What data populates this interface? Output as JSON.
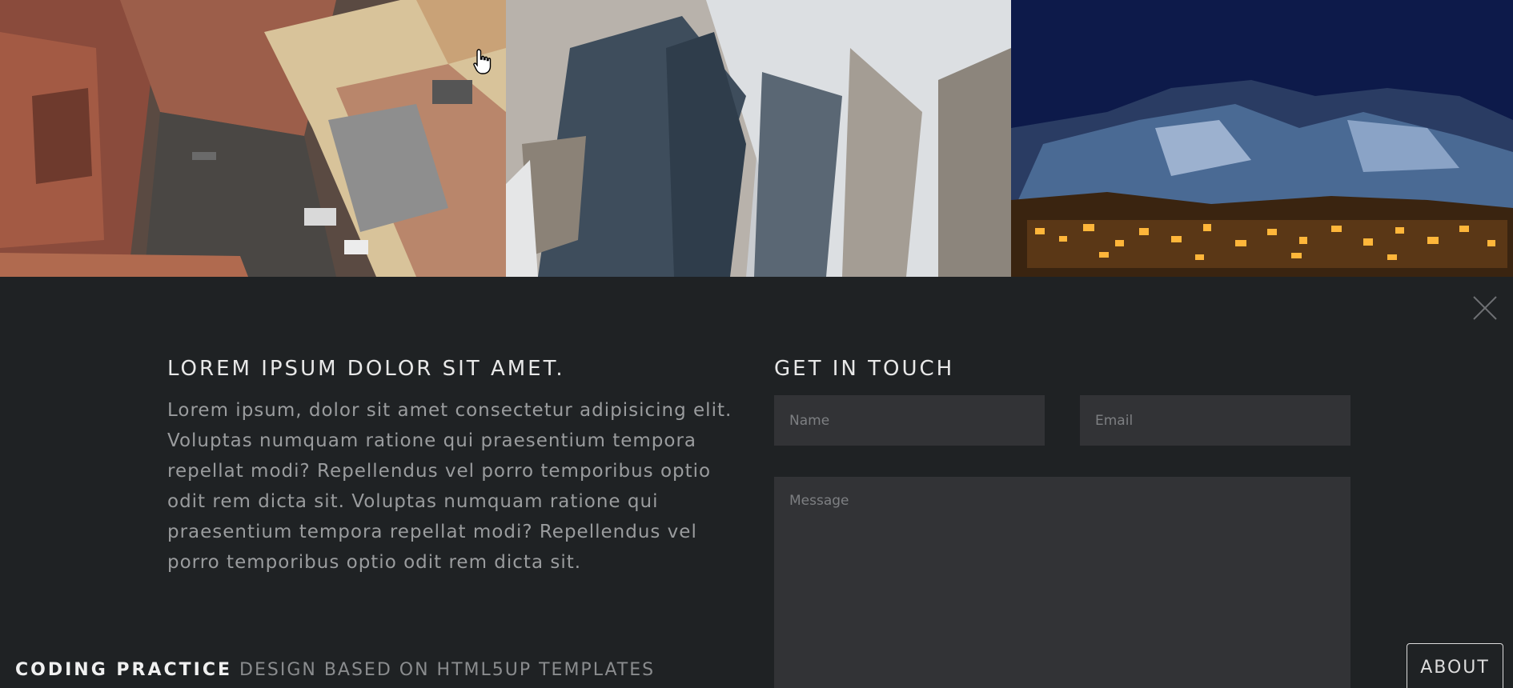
{
  "gallery": {
    "images": [
      {
        "name": "city-rooftops-aerial"
      },
      {
        "name": "snowy-rock-peaks"
      },
      {
        "name": "night-mountain-village"
      }
    ]
  },
  "about": {
    "heading": "LOREM IPSUM DOLOR SIT AMET.",
    "text": "Lorem ipsum, dolor sit amet consectetur adipisicing elit. Voluptas numquam ratione qui praesentium tempora repellat modi? Repellendus vel porro temporibus optio odit rem dicta sit. Voluptas numquam ratione qui praesentium tempora repellat modi? Repellendus vel porro temporibus optio odit rem dicta sit."
  },
  "contact": {
    "heading": "GET IN TOUCH",
    "name_placeholder": "Name",
    "email_placeholder": "Email",
    "message_placeholder": "Message"
  },
  "footer": {
    "brand": "CODING PRACTICE",
    "subtitle": "DESIGN BASED ON HTML5UP TEMPLATES",
    "about_button": "ABOUT"
  },
  "colors": {
    "panel_bg": "#1f2224",
    "field_bg": "#323336"
  },
  "icons": {
    "close": "close-icon",
    "cursor": "hand-pointer-icon"
  }
}
